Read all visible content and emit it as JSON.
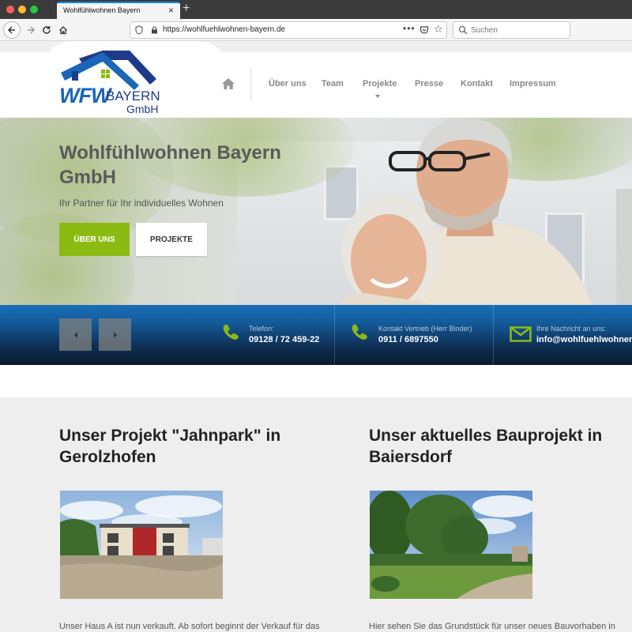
{
  "browser": {
    "tab_title": "Wohlfühlwohnen Bayern",
    "tab_close": "×",
    "new_tab": "+",
    "url": "https://wohlfuehlwohnen-bayern.de",
    "url_more": "•••",
    "search_placeholder": "Suchen"
  },
  "site": {
    "logo": {
      "wfw": "WFW",
      "bayern": "BAYERN",
      "gmbh": "GmbH",
      "colors": {
        "roof": "#1f3a88",
        "accent": "#8bbb12",
        "text": "#1a66b8"
      }
    },
    "menu": {
      "items": [
        "Über uns",
        "Team",
        "Projekte",
        "Presse",
        "Kontakt",
        "Impressum"
      ]
    },
    "hero": {
      "title": "Wohlfühlwohnen Bayern GmbH",
      "subtitle": "Ihr Partner für Ihr individuelles Wohnen",
      "btn_primary": "ÜBER UNS",
      "btn_secondary": "PROJEKTE"
    },
    "contact": [
      {
        "label": "Telefon:",
        "value": "09128 / 72 459-22",
        "icon": "phone-icon"
      },
      {
        "label": "Kontakt Vertrieb (Herr Binder)",
        "value": "0911 / 6897550",
        "icon": "phone-icon"
      },
      {
        "label": "Ihre Nachricht an uns:",
        "value": "info@wohlfuehlwohnen-ba",
        "icon": "mail-icon"
      }
    ],
    "projects": [
      {
        "title": "Unser Projekt \"Jahnpark\" in Gerolzhofen",
        "text": "Unser Haus A ist nun verkauft. Ab sofort beginnt der Verkauf für das"
      },
      {
        "title": "Unser aktuelles Bauprojekt in Baiersdorf",
        "text": "Hier sehen Sie das Grundstück für unser neues Bauvorhaben in"
      }
    ],
    "colors": {
      "green": "#8bbb12",
      "blue": "#135a99",
      "dark": "#0b1a2e"
    }
  }
}
